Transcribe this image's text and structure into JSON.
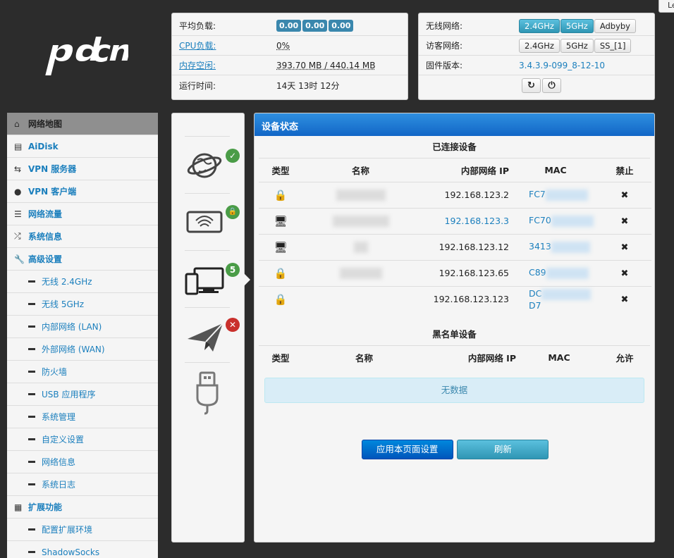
{
  "corner_tab": "Le",
  "logo_text": "pdcn",
  "sysinfo": {
    "load_label": "平均负载:",
    "load_values": [
      "0.00",
      "0.00",
      "0.00"
    ],
    "cpu_label": "CPU负载:",
    "cpu_value": "0%",
    "mem_label": "内存空闲:",
    "mem_value": "393.70 MB / 440.14 MB",
    "uptime_label": "运行时间:",
    "uptime_value": "14天 13时 12分"
  },
  "wifiinfo": {
    "wireless_label": "无线网络:",
    "wireless_buttons": [
      "2.4GHz",
      "5GHz",
      "Adbyby"
    ],
    "guest_label": "访客网络:",
    "guest_buttons": [
      "2.4GHz",
      "5GHz",
      "SS_[1]"
    ],
    "firmware_label": "固件版本:",
    "firmware_value": "3.4.3.9-099_8-12-10",
    "refresh_icon": "refresh-icon",
    "power_icon": "power-icon"
  },
  "sidebar": {
    "items": [
      {
        "label": "网络地图",
        "icon": "home-icon"
      },
      {
        "label": "AiDisk",
        "icon": "hdd-icon"
      },
      {
        "label": "VPN 服务器",
        "icon": "retweet-icon"
      },
      {
        "label": "VPN 客户端",
        "icon": "globe-icon"
      },
      {
        "label": "网络流量",
        "icon": "list-icon"
      },
      {
        "label": "系统信息",
        "icon": "random-icon"
      },
      {
        "label": "高级设置",
        "icon": "wrench-icon"
      }
    ],
    "subitems": [
      "无线 2.4GHz",
      "无线 5GHz",
      "内部网络 (LAN)",
      "外部网络 (WAN)",
      "防火墙",
      "USB 应用程序",
      "系统管理",
      "自定义设置",
      "网络信息",
      "系统日志"
    ],
    "extension_label": "扩展功能",
    "ext_subitems": [
      "配置扩展环境",
      "ShadowSocks"
    ]
  },
  "iconcol": {
    "clients_count": "5"
  },
  "main": {
    "header": "设备状态",
    "connected_title": "已连接设备",
    "columns": [
      "类型",
      "名称",
      "内部网络 IP",
      "MAC",
      "禁止"
    ],
    "rows": [
      {
        "type_icon": "lock-icon",
        "ip": "192.168.123.2",
        "mac": "FC7",
        "ip_link": false
      },
      {
        "type_icon": "monitor-icon",
        "ip": "192.168.123.3",
        "mac": "FC70",
        "ip_link": true
      },
      {
        "type_icon": "monitor-icon",
        "ip": "192.168.123.12",
        "mac": "3413",
        "ip_link": false
      },
      {
        "type_icon": "lock-icon",
        "ip": "192.168.123.65",
        "mac": "C89",
        "ip_link": false
      },
      {
        "type_icon": "lock-icon",
        "ip": "192.168.123.123",
        "mac": "DC",
        "ip_link": false
      }
    ],
    "mac_tail_last": "D7",
    "blacklist_title": "黑名单设备",
    "blacklist_columns": [
      "类型",
      "名称",
      "内部网络 IP",
      "MAC",
      "允许"
    ],
    "no_data": "无数据",
    "apply_label": "应用本页面设置",
    "refresh_label": "刷新"
  }
}
